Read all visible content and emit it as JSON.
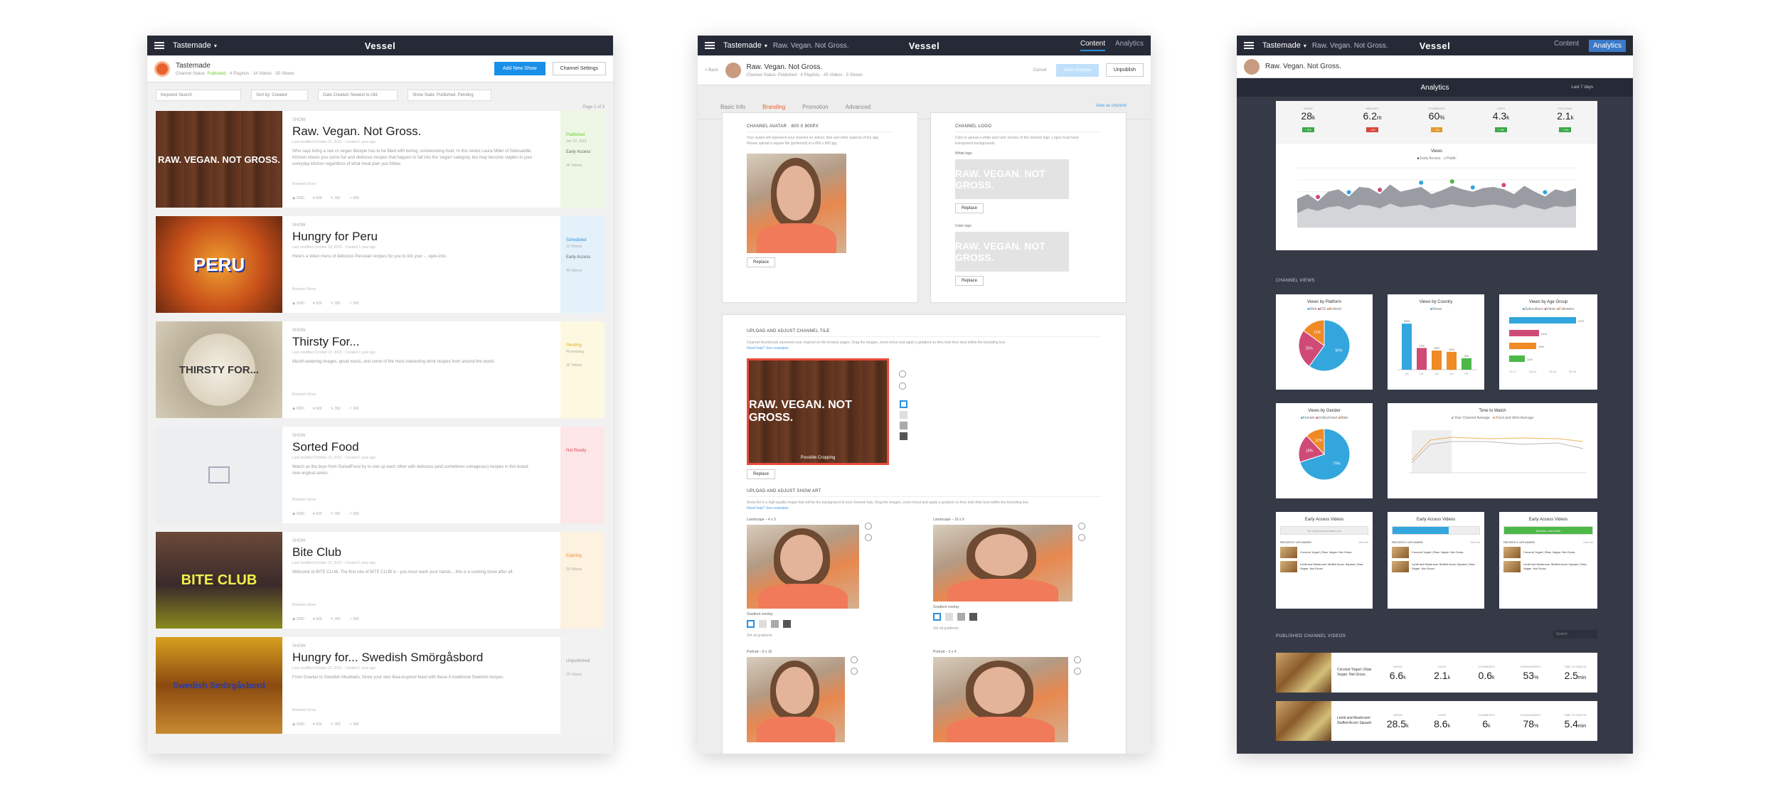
{
  "p1": {
    "brand": "Tastemade",
    "channel": {
      "name": "Tastemade",
      "sub_prefix": "Channel Status:",
      "status": "Published",
      "meta": [
        "4 Playlists",
        "14 Videos",
        "50 Shows"
      ]
    },
    "add_show": "Add New Show",
    "settings": "Channel Settings",
    "filters": [
      "Keyword Search",
      "Sort by: Created",
      "Date Created: Newest to Old",
      "Show State: Published, Pending"
    ],
    "page": "Page 1 of 3",
    "shows": [
      {
        "type": "SHOW",
        "title": "Raw. Vegan. Not Gross.",
        "mod": "Last modified October 22, 2015 · Created 1 year ago",
        "desc": "Who says living a raw vs vegan lifestyle has to be filled with boring, uninteresting food. In this series Laura Miller of Sidesaddle Kitchen shows you some fun and delicious recipes that happen to fall into the 'vegan' category, but may become staples in your everyday kitchen regardless of what meal plan you follow.",
        "brand": "Branded Show",
        "stats": [
          "2000",
          "500",
          "350",
          "300"
        ],
        "status": "Published",
        "status2": "Jan 22, 2016",
        "access": "Early Access",
        "access2": "45 Videos",
        "thumb": "RAW. VEGAN. NOT GROSS."
      },
      {
        "type": "SHOW",
        "title": "Hungry for Peru",
        "mod": "Last modified October 22, 2015 · Created 1 year ago",
        "desc": "Here's a video menu of delicious Peruvian recipes for you to lick your ... eyes into.",
        "brand": "Branded Show",
        "stats": [
          "2000",
          "500",
          "350",
          "300"
        ],
        "status": "Scheduled",
        "status2": "12 Videos",
        "access": "Early Access",
        "access2": "40 Videos",
        "thumb": "PERU"
      },
      {
        "type": "SHOW",
        "title": "Thirsty For...",
        "mod": "Last modified October 22, 2015 · Created 1 year ago",
        "desc": "Mouth-watering images, great music, and some of the most interesting drink recipes from around the world.",
        "brand": "Branded Show",
        "stats": [
          "2000",
          "500",
          "350",
          "300"
        ],
        "status": "Pending",
        "status2": "Processing",
        "access": "",
        "access2": "32 Videos",
        "thumb": "THIRSTY FOR..."
      },
      {
        "type": "SHOW",
        "title": "Sorted Food",
        "mod": "Last modified October 22, 2015 · Created 1 year ago",
        "desc": "Watch as the boys from SortedFood try to one up each other with delicious (and sometimes outrageous) recipes in this brand new original series.",
        "brand": "Branded Show",
        "stats": [
          "2000",
          "500",
          "350",
          "300"
        ],
        "status": "Not Ready",
        "status2": "",
        "access": "",
        "access2": "",
        "thumb": ""
      },
      {
        "type": "SHOW",
        "title": "Bite Club",
        "mod": "Last modified October 22, 2015 · Created 1 year ago",
        "desc": "Welcome to BITE CLUB. The first rule of BITE CLUB is - you must wash your hands... this is a cooking show after all.",
        "brand": "Branded Show",
        "stats": [
          "2000",
          "500",
          "350",
          "300"
        ],
        "status": "Expiring",
        "status2": "",
        "access": "",
        "access2": "20 Videos",
        "thumb": "BITE CLUB"
      },
      {
        "type": "SHOW",
        "title": "Hungry for... Swedish Smörgåsbord",
        "mod": "Last modified October 22, 2015 · Created 1 year ago",
        "desc": "From Gravlax to Swedish Meatballs, throw your own Ikea-inspired feast with these 6 traditional Swedish recipes.",
        "brand": "Branded Show",
        "stats": [
          "2000",
          "500",
          "350",
          "300"
        ],
        "status": "Unpublished",
        "status2": "",
        "access": "",
        "access2": "20 Videos",
        "thumb": "Swedish Smörgåsbord"
      }
    ]
  },
  "p2": {
    "brand": "Tastemade",
    "crumb": "Raw. Vegan. Not Gross.",
    "nav": [
      "Content",
      "Analytics"
    ],
    "back": "< Back",
    "title": "Raw. Vegan. Not Gross.",
    "sub": "Channel Status: Published · 4 Playlists · 45 Videos · 5 Shows",
    "cancel": "Cancel",
    "save": "Save Changes",
    "unpublish": "Unpublish",
    "tabs": [
      "Basic Info",
      "Branding",
      "Promotion",
      "Advanced"
    ],
    "view_channel": "View as channel",
    "avatar": {
      "title": "CHANNEL AVATAR · 800 x 800px",
      "text": "Your avatar will represent your channel on videos, lists and other aspects of the app. Please upload a square file (preferred) in a 800 x 800 jpg.",
      "replace": "Replace"
    },
    "logo": {
      "title": "CHANNEL LOGO",
      "text": "Click to upload a white and color version of the channel logo. Logos must have transparent backgrounds.",
      "white": "White logo",
      "color": "Color logo",
      "logo_text": "RAW. VEGAN. NOT GROSS.",
      "replace": "Replace"
    },
    "tile": {
      "title": "UPLOAD AND ADJUST CHANNEL TILE",
      "text": "Channel thumbnails represent your channel on the browse pages. Drag the images, zoom in/out and apply a gradient so they look their best within the bounding box.",
      "help": "Need help? See examples",
      "tile_text": "RAW. VEGAN. NOT GROSS.",
      "crop": "Possible Cropping",
      "replace": "Replace"
    },
    "art": {
      "title": "UPLOAD AND ADJUST SHOW ART",
      "text": "Show Art is a high quality image that will be the background of your channel hub. Drag the images, zoom in/out and apply a gradient so they look their best within the bounding box.",
      "help": "Need help? See examples",
      "l43": "Landscape – 4 x 3",
      "l169": "Landscape – 16 x 9",
      "p916": "Portrait – 9 x 16",
      "p34": "Portrait – 3 x 4",
      "grad": "Gradient overlay",
      "setall": "Set all gradients"
    }
  },
  "p3": {
    "brand": "Tastemade",
    "crumb": "Raw. Vegan. Not Gross.",
    "nav": [
      "Content",
      "Analytics"
    ],
    "title": "Raw. Vegan. Not Gross.",
    "header": "Analytics",
    "range": "Last 7 days",
    "stats": [
      {
        "l": "VIEWS",
        "v": "28",
        "u": "k",
        "d": "+ 5%",
        "c": "#3aa84a"
      },
      {
        "l": "MINUTES",
        "v": "6.2",
        "u": "m",
        "d": "- 4%",
        "c": "#d9453b"
      },
      {
        "l": "COMMENTS",
        "v": "60",
        "u": "%",
        "d": "- 1%",
        "c": "#e39a2a"
      },
      {
        "l": "LIKES",
        "v": "4.3",
        "u": "k",
        "d": "+ 3%",
        "c": "#3aa84a"
      },
      {
        "l": "FOLLOWS",
        "v": "2.1",
        "u": "k",
        "d": "+ 4%",
        "c": "#3aa84a"
      }
    ],
    "views_title": "Views",
    "views_legend": [
      "Early Access",
      "Public"
    ],
    "channel_views": "CHANNEL VIEWS",
    "platform": {
      "title": "Views by Platform",
      "legend": [
        "Web",
        "iOS",
        "Android"
      ]
    },
    "country": {
      "title": "Views by Country",
      "legend": [
        "Views"
      ]
    },
    "age": {
      "title": "Views by Age Group",
      "legend": [
        "Subscribers",
        "Views",
        "Followers"
      ]
    },
    "gender": {
      "title": "Views by Gender",
      "legend": [
        "Female",
        "Undisclosed",
        "Male"
      ]
    },
    "ttw": {
      "title": "Time to Watch",
      "legend": [
        "Your Channel Average",
        "Food and drink Average"
      ]
    },
    "ea": [
      {
        "title": "Early Access Videos",
        "bar": "No early access videos yet",
        "recent": "RECENTLY UPLOADED",
        "viewall": "View All"
      },
      {
        "title": "Early Access Videos",
        "bar": "",
        "recent": "RECENTLY UPLOADED",
        "viewall": "View All"
      },
      {
        "title": "Early Access Videos",
        "bar": "Woohoo, nice work!",
        "recent": "RECENTLY UPLOADED",
        "viewall": "View All"
      }
    ],
    "ea_items": [
      "Coconut Yogurt | Raw. Vegan. Not Gross.",
      "Lentil and Mushroom Stuffed Acorn Squash | Raw. Vegan. Not Gross."
    ],
    "published": "PUBLISHED CHANNEL VIDEOS",
    "search": "Search",
    "videos": [
      {
        "title": "Coconut Yogurt | Raw Vegan. Not Gross.",
        "views": "6.6",
        "vu": "k",
        "likes": "2.1",
        "lu": "k",
        "comments": "0.6",
        "cu": "k",
        "eng": "53",
        "eu": "%",
        "ttw": "2.5",
        "tu": "min"
      },
      {
        "title": "Lentil and Mushroom Stuffed Acorn Squash",
        "views": "28.5",
        "vu": "k",
        "likes": "8.6",
        "lu": "k",
        "comments": "6",
        "cu": "k",
        "eng": "78",
        "eu": "%",
        "ttw": "5.4",
        "tu": "min"
      }
    ],
    "vlabels": [
      "VIEWS",
      "LIKES",
      "COMMENTS",
      "ENGAGEMENT",
      "TIME TO WATCH"
    ]
  },
  "chart_data": [
    {
      "type": "area",
      "title": "Views",
      "series": [
        {
          "name": "Early Access",
          "values": [
            120,
            140,
            110,
            150,
            160,
            130,
            170,
            165,
            140,
            180,
            150,
            160,
            170,
            140,
            155,
            175,
            160,
            150,
            165,
            170,
            160,
            140,
            175,
            150,
            130,
            160,
            150,
            165
          ]
        },
        {
          "name": "Public",
          "values": [
            60,
            80,
            70,
            85,
            90,
            75,
            95,
            92,
            80,
            100,
            85,
            90,
            95,
            80,
            88,
            98,
            90,
            85,
            92,
            96,
            90,
            80,
            98,
            85,
            75,
            90,
            85,
            92
          ]
        }
      ],
      "ylim": [
        0,
        250
      ]
    },
    {
      "type": "pie",
      "title": "Views by Platform",
      "categories": [
        "Web",
        "iOS",
        "Android"
      ],
      "values": [
        60,
        25,
        15
      ],
      "colors": [
        "#33a6dd",
        "#d04a76",
        "#f08a24"
      ]
    },
    {
      "type": "bar",
      "title": "Views by Country",
      "categories": [
        "US",
        "UK",
        "CA",
        "AU",
        "FR"
      ],
      "values": [
        36,
        17,
        15,
        14,
        9
      ],
      "colors": [
        "#33a6dd",
        "#d04a76",
        "#f08a24",
        "#f08a24",
        "#4cb848"
      ]
    },
    {
      "type": "bar",
      "title": "Views by Age Group",
      "categories": [
        "13-17",
        "18-24",
        "25-34",
        "35-44"
      ],
      "values": [
        47,
        21,
        19,
        11
      ],
      "colors": [
        "#33a6dd",
        "#d04a76",
        "#f08a24",
        "#4cb848"
      ]
    },
    {
      "type": "pie",
      "title": "Views by Gender",
      "categories": [
        "Female",
        "Undisclosed",
        "Male"
      ],
      "values": [
        70,
        18,
        12
      ],
      "colors": [
        "#33a6dd",
        "#d04a76",
        "#f08a24"
      ]
    }
  ]
}
